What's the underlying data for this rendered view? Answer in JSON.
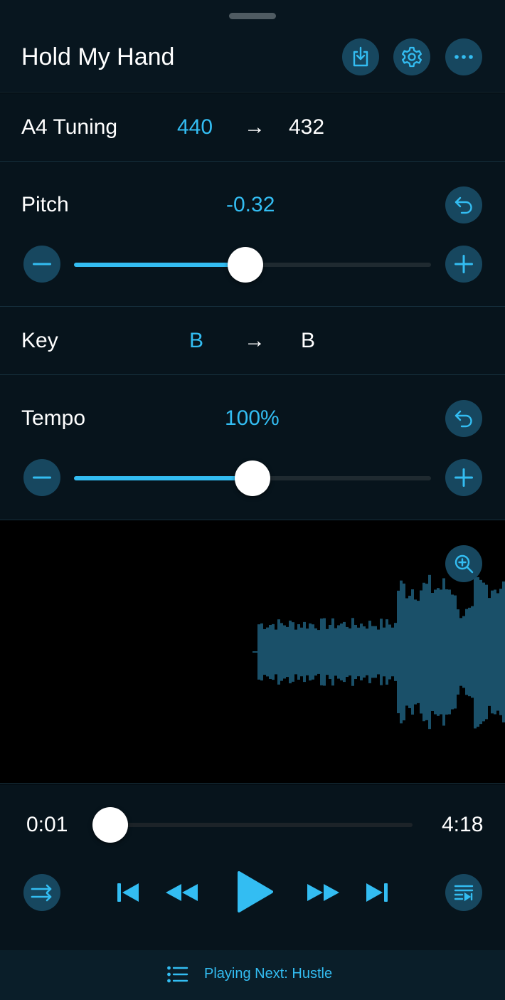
{
  "header": {
    "title": "Hold My Hand",
    "buttons": [
      "download-icon",
      "gear-icon",
      "more-icon"
    ]
  },
  "tuning": {
    "label": "A4 Tuning",
    "from": "440",
    "arrow": "→",
    "to": "432"
  },
  "pitch": {
    "label": "Pitch",
    "value": "-0.32",
    "slider_level": 0.48
  },
  "key": {
    "label": "Key",
    "from": "B",
    "arrow": "→",
    "to": "B"
  },
  "tempo": {
    "label": "Tempo",
    "value": "100%",
    "slider_level": 0.5
  },
  "player": {
    "elapsed": "0:01",
    "total": "4:18",
    "progress": 0.0
  },
  "footer": {
    "playing_next": "Playing Next: Hustle"
  },
  "colors": {
    "accent": "#33bdf2",
    "button_bg": "#17475f",
    "panel_bg": "#07141c",
    "waveform": "#1a5069"
  }
}
